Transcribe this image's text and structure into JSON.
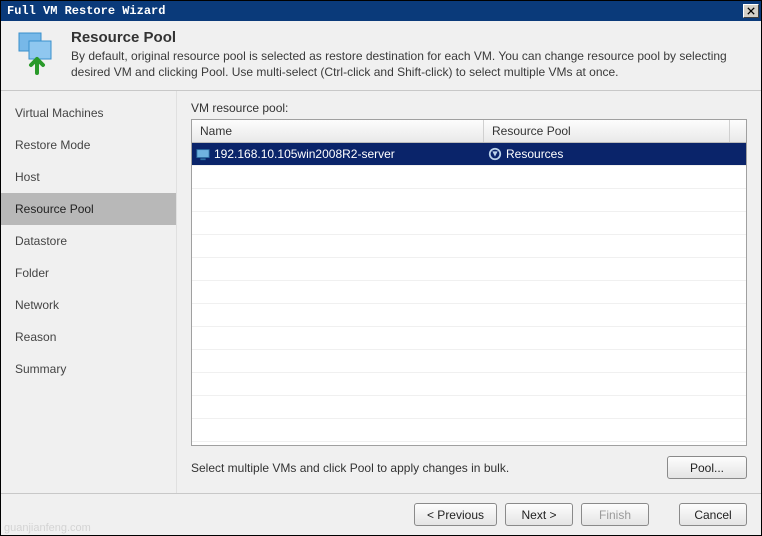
{
  "window": {
    "title": "Full VM Restore Wizard"
  },
  "header": {
    "title": "Resource Pool",
    "subtitle": "By default, original resource pool is selected as restore destination for each VM. You can change resource pool by selecting desired VM and clicking Pool. Use multi-select (Ctrl-click and Shift-click) to select multiple VMs at once."
  },
  "sidebar": {
    "items": [
      {
        "label": "Virtual Machines"
      },
      {
        "label": "Restore Mode"
      },
      {
        "label": "Host"
      },
      {
        "label": "Resource Pool"
      },
      {
        "label": "Datastore"
      },
      {
        "label": "Folder"
      },
      {
        "label": "Network"
      },
      {
        "label": "Reason"
      },
      {
        "label": "Summary"
      }
    ],
    "active_index": 3
  },
  "main": {
    "label": "VM resource pool:",
    "columns": {
      "name": "Name",
      "pool": "Resource Pool"
    },
    "rows": [
      {
        "name": "192.168.10.105win2008R2-server",
        "pool": "Resources"
      }
    ],
    "hint": "Select multiple VMs and click Pool to apply changes in bulk.",
    "pool_button": "Pool..."
  },
  "footer": {
    "previous": "< Previous",
    "next": "Next >",
    "finish": "Finish",
    "cancel": "Cancel"
  },
  "watermark": "guanjianfeng.com"
}
